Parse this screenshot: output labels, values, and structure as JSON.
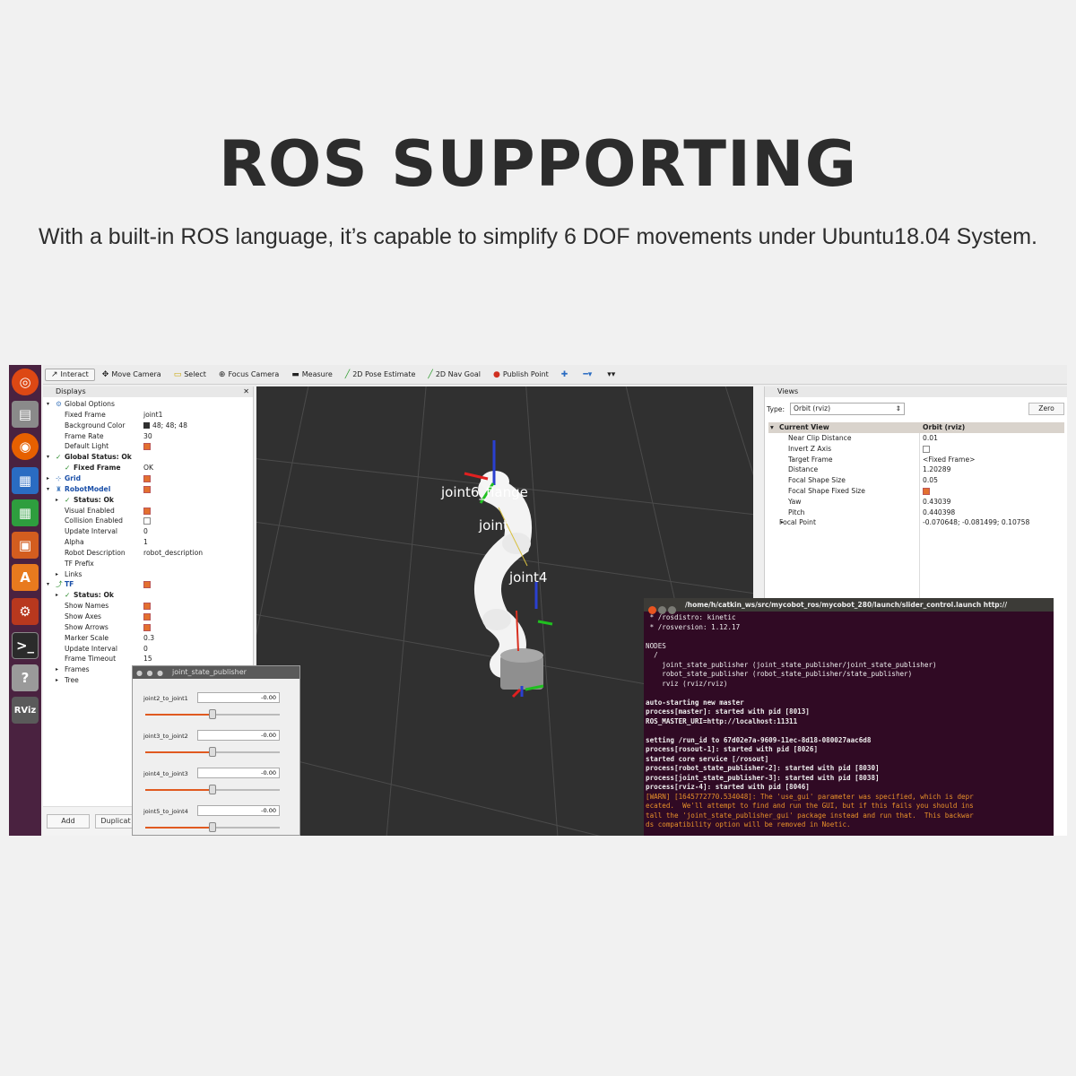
{
  "hero": {
    "title": "ROS SUPPORTING",
    "subtitle": "With a built-in ROS language, it’s capable to simplify 6 DOF movements under Ubuntu18.04 System."
  },
  "toolbar": {
    "interact": "Interact",
    "move_camera": "Move Camera",
    "select": "Select",
    "focus_camera": "Focus Camera",
    "measure": "Measure",
    "pose_estimate": "2D Pose Estimate",
    "nav_goal": "2D Nav Goal",
    "publish_point": "Publish Point"
  },
  "launcher": {
    "rviz_label": "RViz"
  },
  "displays": {
    "title": "Displays",
    "rows": [
      {
        "name": "Global Options",
        "value": ""
      },
      {
        "name": "Fixed Frame",
        "value": "joint1"
      },
      {
        "name": "Background Color",
        "value": "48; 48; 48"
      },
      {
        "name": "Frame Rate",
        "value": "30"
      },
      {
        "name": "Default Light",
        "value": ""
      },
      {
        "name": "Global Status: Ok",
        "value": ""
      },
      {
        "name": "Fixed Frame",
        "value": "OK"
      },
      {
        "name": "Grid",
        "value": ""
      },
      {
        "name": "RobotModel",
        "value": ""
      },
      {
        "name": "Status: Ok",
        "value": ""
      },
      {
        "name": "Visual Enabled",
        "value": ""
      },
      {
        "name": "Collision Enabled",
        "value": ""
      },
      {
        "name": "Update Interval",
        "value": "0"
      },
      {
        "name": "Alpha",
        "value": "1"
      },
      {
        "name": "Robot Description",
        "value": "robot_description"
      },
      {
        "name": "TF Prefix",
        "value": ""
      },
      {
        "name": "Links",
        "value": ""
      },
      {
        "name": "TF",
        "value": ""
      },
      {
        "name": "Status: Ok",
        "value": ""
      },
      {
        "name": "Show Names",
        "value": ""
      },
      {
        "name": "Show Axes",
        "value": ""
      },
      {
        "name": "Show Arrows",
        "value": ""
      },
      {
        "name": "Marker Scale",
        "value": "0.3"
      },
      {
        "name": "Update Interval",
        "value": "0"
      },
      {
        "name": "Frame Timeout",
        "value": "15"
      },
      {
        "name": "Frames",
        "value": ""
      },
      {
        "name": "Tree",
        "value": ""
      }
    ],
    "add_button": "Add",
    "duplicate_button": "Duplicat"
  },
  "view3d": {
    "labels": [
      "joint6_flange",
      "joint",
      "joint4"
    ]
  },
  "views": {
    "title": "Views",
    "type_label": "Type:",
    "type_value": "Orbit (rviz)",
    "zero_button": "Zero",
    "current_view": "Current View",
    "current_view_value": "Orbit (rviz)",
    "rows": [
      {
        "name": "Near Clip Distance",
        "value": "0.01"
      },
      {
        "name": "Invert Z Axis",
        "value": ""
      },
      {
        "name": "Target Frame",
        "value": "<Fixed Frame>"
      },
      {
        "name": "Distance",
        "value": "1.20289"
      },
      {
        "name": "Focal Shape Size",
        "value": "0.05"
      },
      {
        "name": "Focal Shape Fixed Size",
        "value": ""
      },
      {
        "name": "Yaw",
        "value": "0.43039"
      },
      {
        "name": "Pitch",
        "value": "0.440398"
      },
      {
        "name": "Focal Point",
        "value": "-0.070648; -0.081499; 0.10758"
      }
    ]
  },
  "jsp": {
    "title": "joint_state_publisher",
    "joints": [
      {
        "name": "joint2_to_joint1",
        "value": "-0.00",
        "position": 0.5
      },
      {
        "name": "joint3_to_joint2",
        "value": "-0.00",
        "position": 0.5
      },
      {
        "name": "joint4_to_joint3",
        "value": "-0.00",
        "position": 0.5
      },
      {
        "name": "joint5_to_joint4",
        "value": "-0.00",
        "position": 0.5
      }
    ]
  },
  "terminal": {
    "title": "/home/h/catkin_ws/src/mycobot_ros/mycobot_280/launch/slider_control.launch http://",
    "lines": [
      " * /rosdistro: kinetic",
      " * /rosversion: 1.12.17",
      "",
      "NODES",
      "  /",
      "    joint_state_publisher (joint_state_publisher/joint_state_publisher)",
      "    robot_state_publisher (robot_state_publisher/state_publisher)",
      "    rviz (rviz/rviz)",
      "",
      "auto-starting new master",
      "process[master]: started with pid [8013]",
      "ROS_MASTER_URI=http://localhost:11311",
      "",
      "setting /run_id to 67d02e7a-9609-11ec-8d18-080027aac6d8",
      "process[rosout-1]: started with pid [8026]",
      "started core service [/rosout]",
      "process[robot_state_publisher-2]: started with pid [8030]",
      "process[joint_state_publisher-3]: started with pid [8038]",
      "process[rviz-4]: started with pid [8046]",
      "[WARN] [1645772770.534048]: The 'use_gui' parameter was specified, which is depr",
      "ecated.  We'll attempt to find and run the GUI, but if this fails you should ins",
      "tall the 'joint_state_publisher_gui' package instead and run that.  This backwar",
      "ds compatibility option will be removed in Noetic."
    ]
  }
}
